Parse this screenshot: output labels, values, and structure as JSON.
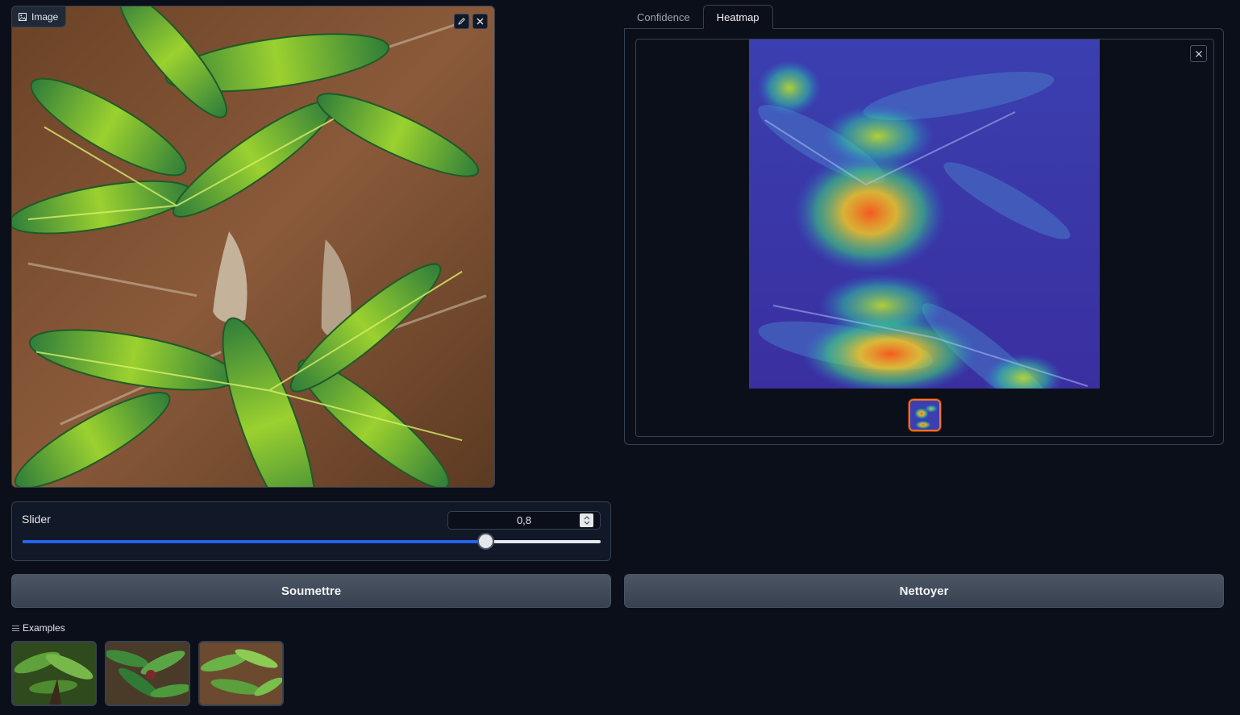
{
  "input_panel": {
    "label": "Image"
  },
  "slider": {
    "label": "Slider",
    "value": "0,8",
    "fraction": 0.8
  },
  "buttons": {
    "submit": "Soumettre",
    "clear": "Nettoyer"
  },
  "examples": {
    "label": "Examples"
  },
  "tabs": [
    {
      "label": "Confidence",
      "active": false
    },
    {
      "label": "Heatmap",
      "active": true
    }
  ],
  "icons": {
    "image": "image-icon",
    "edit": "pencil-icon",
    "close": "close-icon",
    "spinner": "spinner-arrows-icon",
    "examples": "list-icon",
    "gallery_close": "close-icon"
  },
  "colors": {
    "background": "#0b0f19",
    "accent": "#2563eb",
    "selected": "#f97316"
  }
}
